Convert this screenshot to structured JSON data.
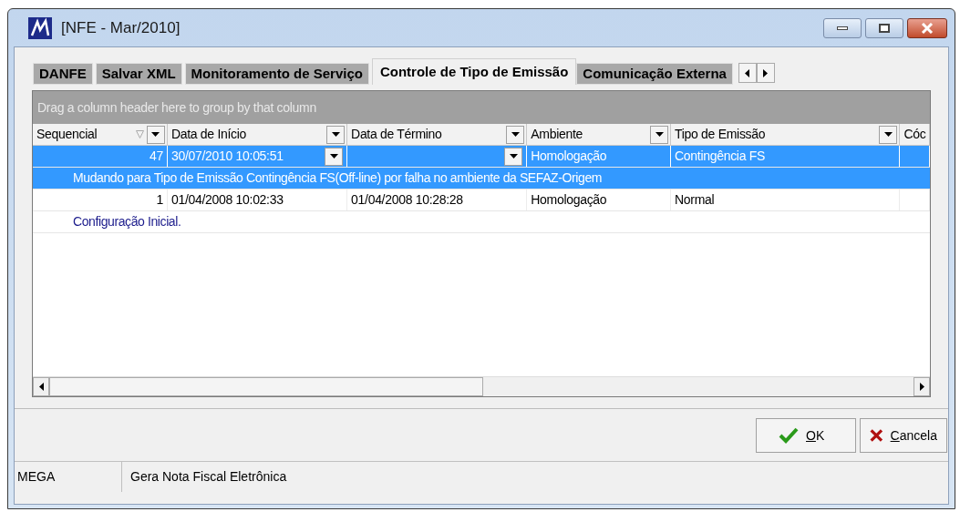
{
  "window": {
    "title": "[NFE - Mar/2010]"
  },
  "tabs": [
    {
      "label": "DANFE",
      "selected": false
    },
    {
      "label": "Salvar XML",
      "selected": false
    },
    {
      "label": "Monitoramento de Serviço",
      "selected": false
    },
    {
      "label": "Controle de Tipo de Emissão",
      "selected": true
    },
    {
      "label": "Comunicação Externa",
      "selected": false
    }
  ],
  "group_panel": {
    "text": "Drag a column header here to group by that column"
  },
  "table": {
    "columns": [
      {
        "label": "Sequencial",
        "sorted": true
      },
      {
        "label": "Data de Início",
        "sorted": false
      },
      {
        "label": "Data de Término",
        "sorted": false
      },
      {
        "label": "Ambiente",
        "sorted": false
      },
      {
        "label": "Tipo de Emissão",
        "sorted": false
      },
      {
        "label": "Cóc",
        "sorted": false
      }
    ],
    "rows": [
      {
        "selected": true,
        "cells": [
          "47",
          "30/07/2010 10:05:51",
          "",
          "Homologação",
          "Contingência FS",
          ""
        ],
        "description": "Mudando para Tipo de Emissão Contingência FS(Off-line) por falha no ambiente da SEFAZ-Origem"
      },
      {
        "selected": false,
        "cells": [
          "1",
          "01/04/2008 10:02:33",
          "01/04/2008 10:28:28",
          "Homologação",
          "Normal",
          ""
        ],
        "description": "Configuração Inicial."
      }
    ]
  },
  "buttons": [
    {
      "kind": "ok",
      "label": "OK"
    },
    {
      "kind": "cancel",
      "label": "Cancela"
    }
  ],
  "status_bar": {
    "left": "MEGA",
    "right": "Gera Nota Fiscal Eletrônica"
  }
}
